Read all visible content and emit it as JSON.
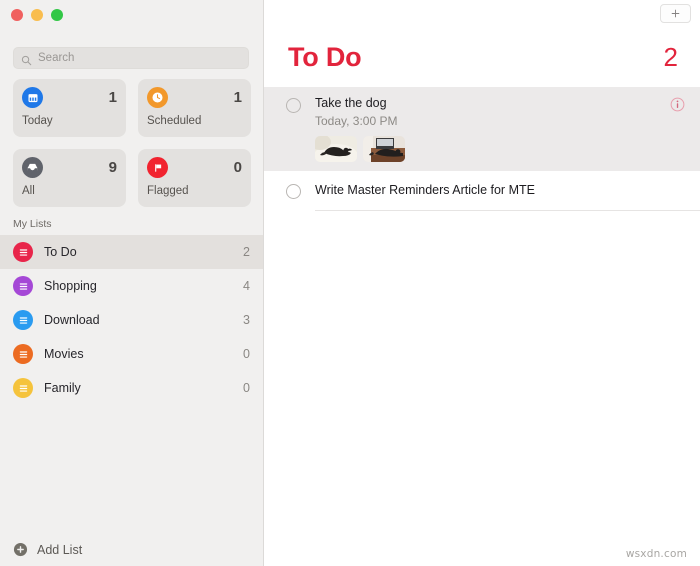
{
  "window": {
    "traffic_lights": [
      {
        "name": "close",
        "color": "#f0605f"
      },
      {
        "name": "minimize",
        "color": "#f9bd4e"
      },
      {
        "name": "maximize",
        "color": "#32c746"
      }
    ]
  },
  "sidebar": {
    "search": {
      "placeholder": "Search",
      "value": ""
    },
    "smart_lists": [
      {
        "label": "Today",
        "count": "1",
        "icon": "calendar-icon",
        "color": "#1f78e8"
      },
      {
        "label": "Scheduled",
        "count": "1",
        "icon": "clock-icon",
        "color": "#f2982b"
      },
      {
        "label": "All",
        "count": "9",
        "icon": "tray-icon",
        "color": "#60636b"
      },
      {
        "label": "Flagged",
        "count": "0",
        "icon": "flag-icon",
        "color": "#f1232f"
      }
    ],
    "my_lists_header": "My Lists",
    "lists": [
      {
        "label": "To Do",
        "count": "2",
        "color": "#e8254a",
        "selected": true
      },
      {
        "label": "Shopping",
        "count": "4",
        "color": "#a548d6",
        "selected": false
      },
      {
        "label": "Download",
        "count": "3",
        "color": "#2a9bf0",
        "selected": false
      },
      {
        "label": "Movies",
        "count": "0",
        "color": "#ec6b21",
        "selected": false
      },
      {
        "label": "Family",
        "count": "0",
        "color": "#f5c33c",
        "selected": false
      }
    ],
    "add_list_label": "Add List"
  },
  "main": {
    "add_reminder_tooltip": "+",
    "list_title": "To Do",
    "list_count": "2",
    "accent_color": "#e2243c",
    "reminders": [
      {
        "title": "Take the dog",
        "due": "Today, 3:00 PM",
        "completed": false,
        "selected": true,
        "has_info": true,
        "attachments": [
          "dog-on-white-bed-photo",
          "dog-on-brown-couch-photo"
        ]
      },
      {
        "title": "Write Master Reminders Article for MTE",
        "due": "",
        "completed": false,
        "selected": false,
        "has_info": false,
        "attachments": []
      }
    ]
  },
  "watermark": "wsxdn.com"
}
